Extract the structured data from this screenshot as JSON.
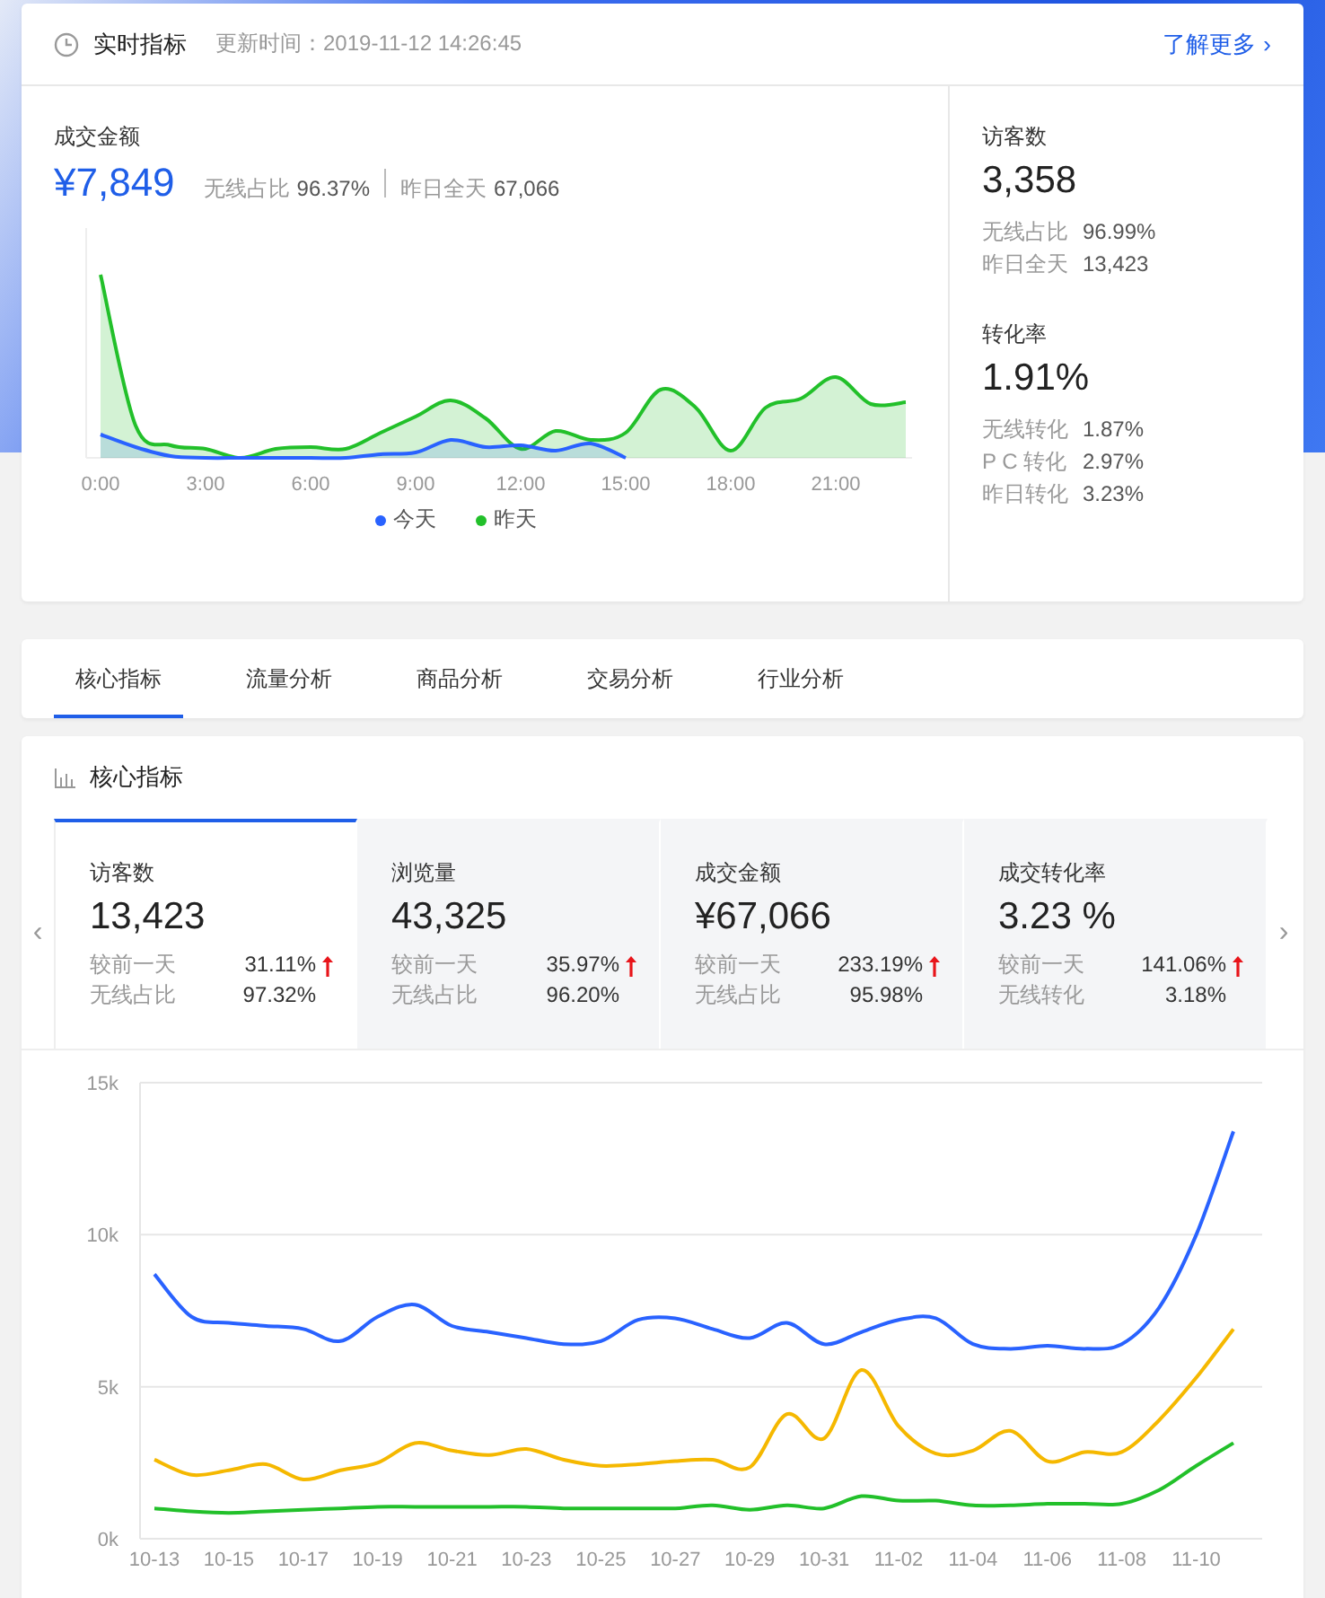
{
  "realtime": {
    "title": "实时指标",
    "update_time": "更新时间：2019-11-12 14:26:45",
    "more_link": "了解更多",
    "more_icon": "›",
    "amount": {
      "label": "成交金额",
      "value": "¥7,849",
      "stats": [
        {
          "label": "无线占比",
          "value": "96.37%"
        },
        {
          "label": "昨日全天",
          "value": "67,066"
        }
      ]
    },
    "chart": {
      "x_labels": [
        "0:00",
        "3:00",
        "6:00",
        "9:00",
        "12:00",
        "15:00",
        "18:00",
        "21:00"
      ],
      "legend": [
        {
          "label": "今天",
          "color": "#2962ff"
        },
        {
          "label": "昨天",
          "color": "#22c02a"
        }
      ]
    },
    "side": [
      {
        "label": "访客数",
        "value": "3,358",
        "stats": [
          {
            "label": "无线占比",
            "value": "96.99%"
          },
          {
            "label": "昨日全天",
            "value": "13,423"
          }
        ]
      },
      {
        "label": "转化率",
        "value": "1.91%",
        "stats": [
          {
            "label": "无线转化",
            "value": "1.87%"
          },
          {
            "label": "P C 转化",
            "value": "2.97%"
          },
          {
            "label": "昨日转化",
            "value": "3.23%"
          }
        ]
      }
    ]
  },
  "tabs": [
    {
      "label": "核心指标",
      "selected": true
    },
    {
      "label": "流量分析",
      "selected": false
    },
    {
      "label": "商品分析",
      "selected": false
    },
    {
      "label": "交易分析",
      "selected": false
    },
    {
      "label": "行业分析",
      "selected": false
    }
  ],
  "core": {
    "title": "核心指标",
    "prev_icon": "‹",
    "next_icon": "›",
    "metrics": [
      {
        "label": "访客数",
        "value": "13,423",
        "selected": true,
        "rows": [
          {
            "label": "较前一天",
            "value": "31.11%",
            "rising": true
          },
          {
            "label": "无线占比",
            "value": "97.32%"
          }
        ]
      },
      {
        "label": "浏览量",
        "value": "43,325",
        "selected": false,
        "rows": [
          {
            "label": "较前一天",
            "value": "35.97%",
            "rising": true
          },
          {
            "label": "无线占比",
            "value": "96.20%"
          }
        ]
      },
      {
        "label": "成交金额",
        "value": "¥67,066",
        "selected": false,
        "rows": [
          {
            "label": "较前一天",
            "value": "233.19%",
            "rising": true
          },
          {
            "label": "无线占比",
            "value": "95.98%"
          }
        ]
      },
      {
        "label": "成交转化率",
        "value": "3.23 %",
        "selected": false,
        "rows": [
          {
            "label": "较前一天",
            "value": "141.06%",
            "rising": true
          },
          {
            "label": "无线转化",
            "value": "3.18%"
          }
        ]
      }
    ],
    "chart_data": {
      "type": "line",
      "categories": [
        "10-13",
        null,
        "10-15",
        null,
        "10-17",
        null,
        "10-19",
        null,
        "10-21",
        null,
        "10-23",
        null,
        "10-25",
        null,
        "10-27",
        null,
        "10-29",
        null,
        "10-31",
        null,
        "11-02",
        null,
        "11-04",
        null,
        "11-06",
        null,
        "11-08",
        null,
        "11-10",
        null
      ],
      "ylim": [
        0,
        15000
      ],
      "yticks": [
        {
          "value": 0,
          "label": "0k"
        },
        {
          "value": 5000,
          "label": "5k"
        },
        {
          "value": 10000,
          "label": "10k"
        },
        {
          "value": 15000,
          "label": "15k"
        }
      ],
      "series": [
        {
          "color": "#2962ff",
          "values": [
            8700,
            7300,
            7100,
            7000,
            6900,
            6500,
            7300,
            7700,
            7000,
            6800,
            6600,
            6400,
            6500,
            7200,
            7250,
            6900,
            6600,
            7100,
            6400,
            6800,
            7200,
            7250,
            6400,
            6250,
            6350,
            6250,
            6400,
            7600,
            10000,
            13400
          ]
        },
        {
          "color": "#f5b800",
          "values": [
            2600,
            2100,
            2250,
            2450,
            1950,
            2250,
            2500,
            3150,
            2900,
            2750,
            2950,
            2600,
            2400,
            2450,
            2550,
            2600,
            2350,
            4100,
            3300,
            5550,
            3700,
            2800,
            2900,
            3550,
            2550,
            2850,
            2850,
            3900,
            5300,
            6900
          ]
        },
        {
          "color": "#22c02a",
          "values": [
            1000,
            900,
            850,
            900,
            950,
            1000,
            1050,
            1050,
            1050,
            1050,
            1050,
            1000,
            1000,
            1000,
            1000,
            1100,
            950,
            1100,
            1000,
            1400,
            1250,
            1250,
            1100,
            1100,
            1150,
            1150,
            1150,
            1600,
            2400,
            3150
          ]
        }
      ]
    }
  }
}
